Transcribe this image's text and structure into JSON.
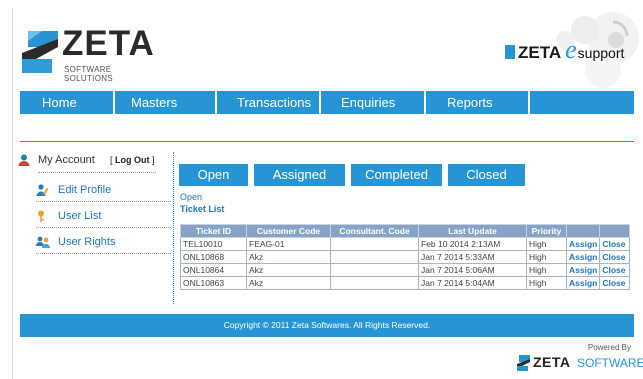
{
  "brand": {
    "name": "ZETA",
    "tagline": "SOFTWARE SOLUTIONS",
    "esupport_name": "ZETA",
    "esupport_e": "e",
    "esupport_suffix": "support",
    "accent": "#2795d3"
  },
  "nav": [
    {
      "label": "Home"
    },
    {
      "label": "Masters"
    },
    {
      "label": "Transactions"
    },
    {
      "label": "Enquiries"
    },
    {
      "label": "Reports"
    }
  ],
  "sidebar": {
    "account_label": "My Account",
    "logout_label": "Log Out",
    "items": [
      {
        "label": "Edit Profile",
        "icon": "user-edit-icon"
      },
      {
        "label": "User List",
        "icon": "key-icon"
      },
      {
        "label": "User Rights",
        "icon": "users-icon"
      }
    ]
  },
  "tabs": [
    {
      "label": "Open"
    },
    {
      "label": "Assigned"
    },
    {
      "label": "Completed"
    },
    {
      "label": "Closed"
    }
  ],
  "breadcrumb": {
    "status": "Open",
    "section": "Ticket List"
  },
  "table": {
    "headers": [
      "Ticket ID",
      "Customer Code",
      "Consultant. Code",
      "Last Update",
      "Priority",
      "",
      ""
    ],
    "rows": [
      {
        "id": "TEL10010",
        "customer": "FEAG-01",
        "consultant": "",
        "updated": "Feb 10 2014 2:13AM",
        "priority": "High",
        "assign": "Assign",
        "close": "Close"
      },
      {
        "id": "ONL10868",
        "customer": "Akz",
        "consultant": "",
        "updated": "Jan 7 2014 5:33AM",
        "priority": "High",
        "assign": "Assign",
        "close": "Close"
      },
      {
        "id": "ONL10864",
        "customer": "Akz",
        "consultant": "",
        "updated": "Jan 7 2014 5:06AM",
        "priority": "High",
        "assign": "Assign",
        "close": "Close"
      },
      {
        "id": "ONL10863",
        "customer": "Akz",
        "consultant": "",
        "updated": "Jan 7 2014 5:04AM",
        "priority": "High",
        "assign": "Assign",
        "close": "Close"
      }
    ]
  },
  "footer": {
    "copyright": "Copyright © 2011 Zeta Softwares. All Rights Reserved.",
    "powered_by": "Powered By",
    "powered_zeta": "ZETA",
    "powered_software": "SOFTWARE"
  }
}
